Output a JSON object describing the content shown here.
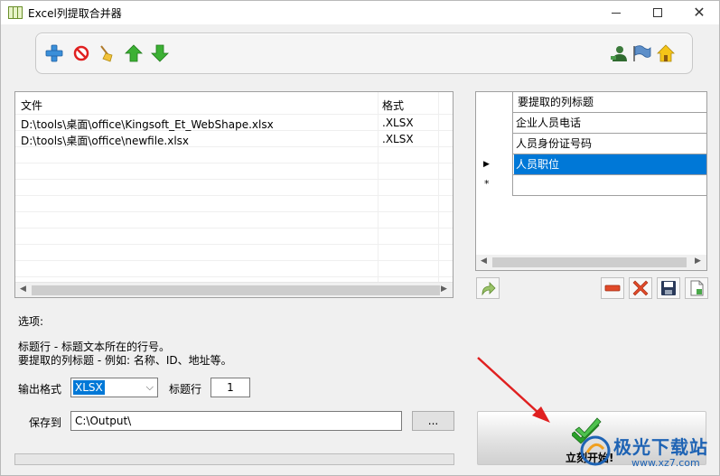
{
  "window": {
    "title": "Excel列提取合并器"
  },
  "file_table": {
    "headers": [
      "文件",
      "格式"
    ],
    "rows": [
      {
        "file": "D:\\tools\\桌面\\office\\Kingsoft_Et_WebShape.xlsx",
        "format": ".XLSX"
      },
      {
        "file": "D:\\tools\\桌面\\office\\newfile.xlsx",
        "format": ".XLSX"
      }
    ]
  },
  "column_grid": {
    "header": "要提取的列标题",
    "rows": [
      "企业人员电话",
      "人员身份证号码",
      "人员职位"
    ],
    "selected_index": 2
  },
  "options": {
    "title": "选项:",
    "help_line1": "标题行 - 标题文本所在的行号。",
    "help_line2": "要提取的列标题 - 例如: 名称、ID、地址等。",
    "output_format_label": "输出格式",
    "output_format_value": "XLSX",
    "header_row_label": "标题行",
    "header_row_value": "1",
    "save_to_label": "保存到",
    "save_to_value": "C:\\Output\\",
    "browse_label": "..."
  },
  "start_button": {
    "label": "立刻开始!"
  },
  "watermark": {
    "text": "极光下载站",
    "url": "www.xz7.com"
  },
  "colors": {
    "accent": "#0078d7",
    "window_bg": "#f0f0f0",
    "arrow_red": "#e02020",
    "watermark_blue": "#1e63b4"
  }
}
